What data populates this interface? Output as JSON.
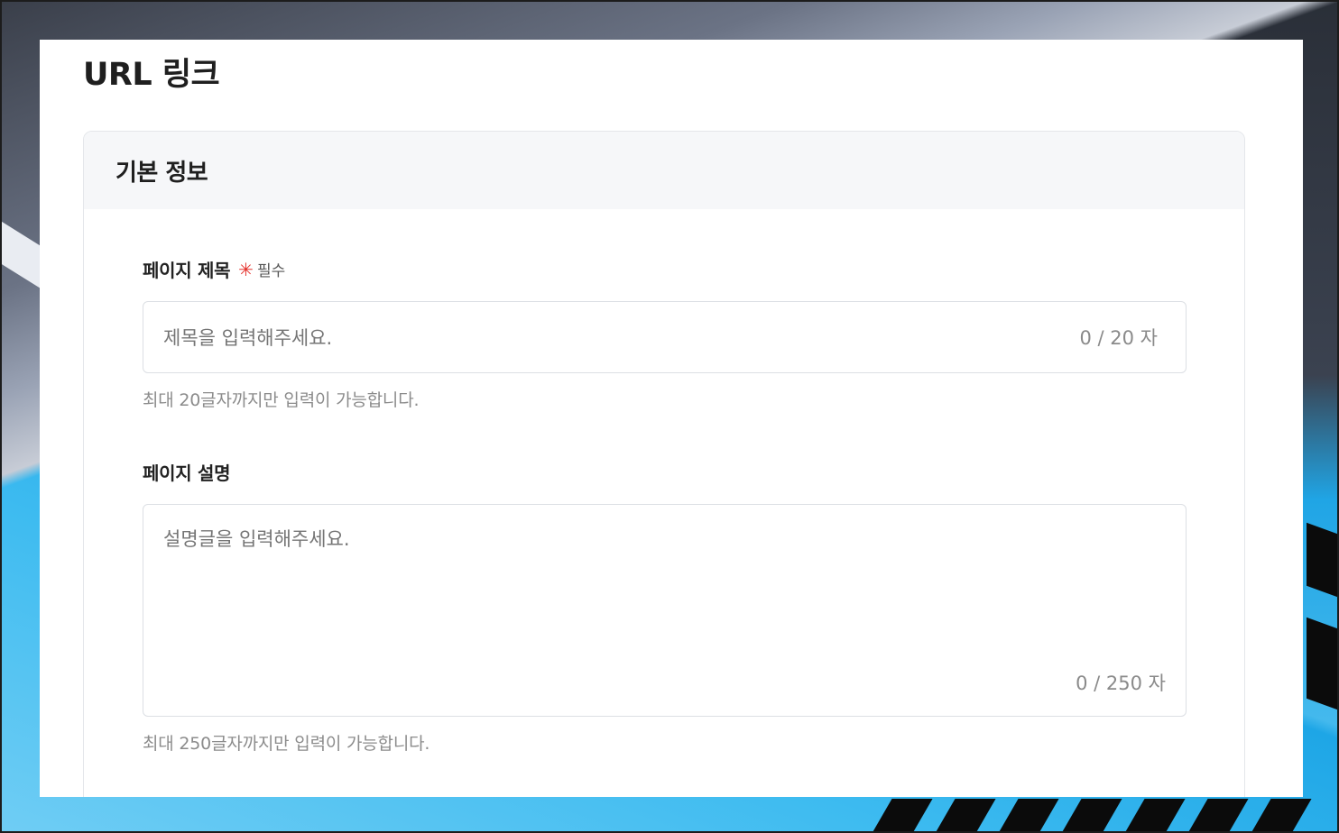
{
  "page": {
    "title": "URL 링크"
  },
  "section": {
    "title": "기본 정보"
  },
  "fields": {
    "title": {
      "label": "페이지 제목",
      "required_mark": "✳",
      "required_text": "필수",
      "placeholder": "제목을 입력해주세요.",
      "value": "",
      "counter": "0 / 20 자",
      "helper": "최대 20글자까지만 입력이 가능합니다."
    },
    "description": {
      "label": "페이지 설명",
      "placeholder": "설명글을 입력해주세요.",
      "value": "",
      "counter": "0 / 250 자",
      "helper": "최대 250글자까지만 입력이 가능합니다."
    }
  },
  "colors": {
    "required": "#e5322d",
    "card_header_bg": "#f6f7f9",
    "border": "#dcdfe4",
    "placeholder": "#9a9a9a"
  },
  "icons": {
    "required_mark": "asterisk-icon"
  }
}
